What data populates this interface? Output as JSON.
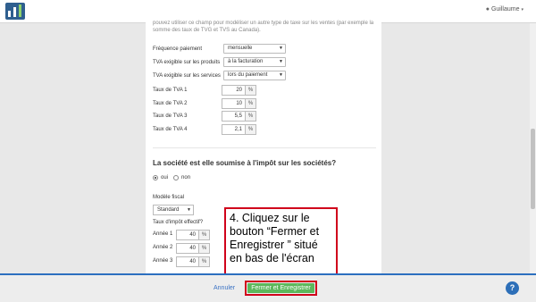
{
  "header": {
    "user_name": "Guillaume",
    "user_icon": "user-icon",
    "caret": "▾"
  },
  "intro_text": "pouvez utiliser ce champ pour modéliser un autre type de taxe sur les ventes (par exemple la somme des taux de TVG et TVS au Canada).",
  "vat_settings": [
    {
      "label": "Fréquence paiement",
      "value": "mensuelle"
    },
    {
      "label": "TVA exigible sur les produits",
      "value": "à la facturation"
    },
    {
      "label": "TVA exigible sur les services",
      "value": "lors du paiement"
    }
  ],
  "vat_rates": [
    {
      "label": "Taux de TVA 1",
      "value": "20",
      "unit": "%"
    },
    {
      "label": "Taux de TVA 2",
      "value": "10",
      "unit": "%"
    },
    {
      "label": "Taux de TVA 3",
      "value": "5,5",
      "unit": "%"
    },
    {
      "label": "Taux de TVA 4",
      "value": "2,1",
      "unit": "%"
    }
  ],
  "corporate_tax": {
    "question": "La société est elle soumise à l'impôt sur les sociétés?",
    "option_yes": "oui",
    "option_no": "non",
    "selected": "oui",
    "model_label": "Modèle fiscal",
    "model_value": "Standard",
    "rate_label": "Taux d'impôt effectif?",
    "years": [
      {
        "label": "Année 1",
        "value": "40",
        "unit": "%"
      },
      {
        "label": "Année 2",
        "value": "40",
        "unit": "%"
      },
      {
        "label": "Année 3",
        "value": "40",
        "unit": "%"
      }
    ]
  },
  "callout": {
    "text": "4. Cliquez sur le bouton “Fermer et Enregistrer ” situé en bas de l'écran",
    "border_color": "#d0021b"
  },
  "footer": {
    "cancel_label": "Annuler",
    "save_label": "Fermer et Enregistrer",
    "help_label": "?",
    "accent": "#2c6fbf",
    "save_color": "#5cb85c"
  }
}
